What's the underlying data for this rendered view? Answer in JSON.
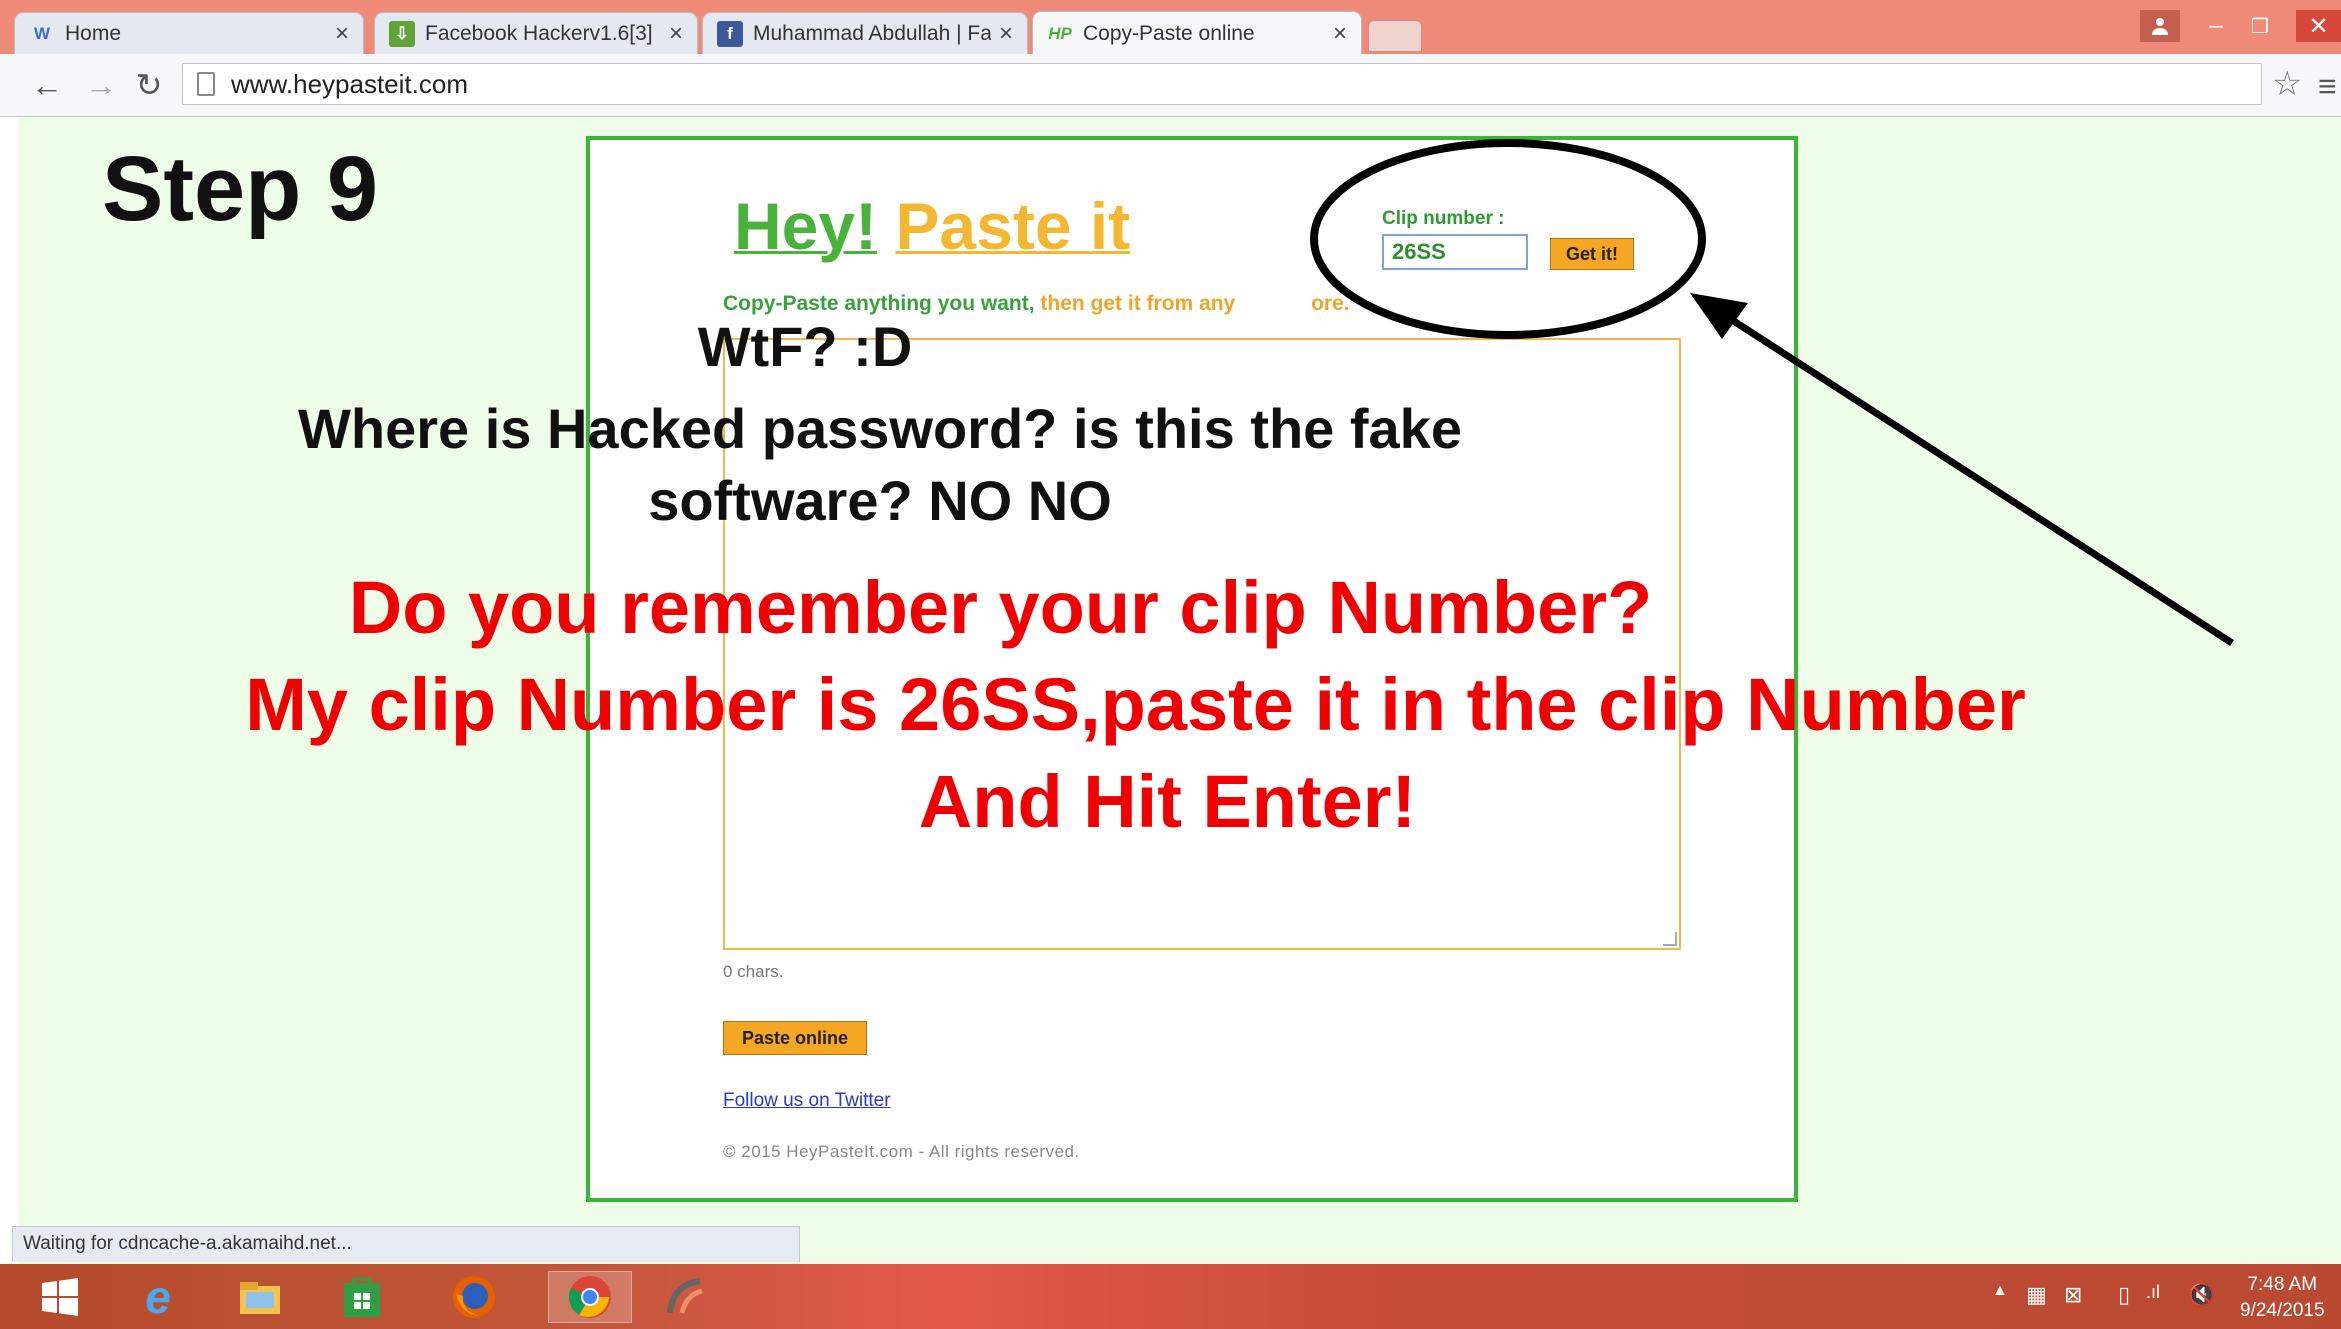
{
  "browser": {
    "tabs": [
      {
        "label": "Home",
        "icon": "w-logo-icon",
        "close": "×"
      },
      {
        "label": "Facebook Hackerv1.6[3]",
        "icon": "download-icon",
        "close": "×"
      },
      {
        "label": "Muhammad Abdullah | Fa",
        "icon": "facebook-icon",
        "close": "×"
      },
      {
        "label": "Copy-Paste online",
        "icon": "hp-logo-icon",
        "close": "×"
      }
    ],
    "url": "www.heypasteit.com",
    "status": "Waiting for cdncache-a.akamaihd.net..."
  },
  "page": {
    "logo_hey": "Hey!",
    "logo_paste": "Paste it",
    "tagline_green": "Copy-Paste anything you want,",
    "tagline_orange": "then get it from any",
    "tagline_orange_end": "ore.",
    "clip_label": "Clip number :",
    "clip_value": "26SS",
    "get_button": "Get it!",
    "chars": "0 chars.",
    "paste_button": "Paste online",
    "twitter_link": "Follow us on Twitter",
    "copyright": "© 2015  HeyPasteIt.com  -  All rights reserved."
  },
  "overlay": {
    "step": "Step 9",
    "wtf": "WtF? :D",
    "line1": "Where is Hacked password? is this the fake",
    "line2": "software? NO NO",
    "red1": "Do you remember your clip Number?",
    "red2": "My clip Number is 26SS,paste it in the clip Number",
    "red3": "And Hit Enter!"
  },
  "taskbar": {
    "time": "7:48 AM",
    "date": "9/24/2015"
  },
  "colors": {
    "titlebar": "#ef8a78",
    "page_bg": "#eefde7",
    "frame_green": "#3cb43c",
    "logo_green": "#49b23b",
    "logo_orange": "#f3b731",
    "button_orange": "#f5a623",
    "annotation_red": "#f00000"
  }
}
